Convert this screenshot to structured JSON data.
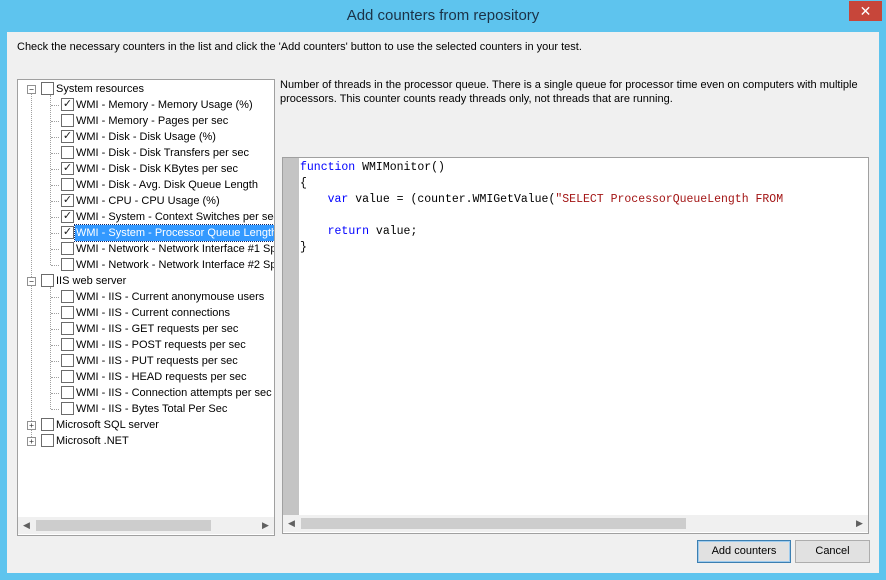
{
  "window": {
    "title": "Add counters from repository",
    "close_glyph": "✕"
  },
  "instruction": "Check the necessary counters in the list and click the 'Add counters' button to use the selected counters in your test.",
  "tree": {
    "groups": [
      {
        "label": "System resources",
        "expander": "−",
        "checked": false,
        "items": [
          {
            "label": "WMI - Memory - Memory Usage (%)",
            "checked": true
          },
          {
            "label": "WMI - Memory - Pages per sec",
            "checked": false
          },
          {
            "label": "WMI - Disk - Disk Usage (%)",
            "checked": true
          },
          {
            "label": "WMI - Disk - Disk Transfers per sec",
            "checked": false
          },
          {
            "label": "WMI - Disk - Disk KBytes per sec",
            "checked": true
          },
          {
            "label": "WMI - Disk - Avg. Disk Queue Length",
            "checked": false
          },
          {
            "label": "WMI - CPU - CPU Usage (%)",
            "checked": true
          },
          {
            "label": "WMI - System - Context Switches per sec",
            "checked": true
          },
          {
            "label": "WMI - System - Processor Queue Length",
            "checked": true,
            "selected": true
          },
          {
            "label": "WMI - Network - Network Interface #1 Sp",
            "checked": false
          },
          {
            "label": "WMI - Network - Network Interface #2 Sp",
            "checked": false
          }
        ]
      },
      {
        "label": "IIS web server",
        "expander": "−",
        "checked": false,
        "items": [
          {
            "label": "WMI - IIS - Current anonymouse users",
            "checked": false
          },
          {
            "label": "WMI - IIS - Current connections",
            "checked": false
          },
          {
            "label": "WMI - IIS - GET requests per sec",
            "checked": false
          },
          {
            "label": "WMI - IIS - POST requests per sec",
            "checked": false
          },
          {
            "label": "WMI - IIS - PUT requests per sec",
            "checked": false
          },
          {
            "label": "WMI - IIS - HEAD requests per sec",
            "checked": false
          },
          {
            "label": "WMI - IIS - Connection attempts per sec",
            "checked": false
          },
          {
            "label": "WMI - IIS - Bytes Total Per Sec",
            "checked": false
          }
        ]
      },
      {
        "label": "Microsoft SQL server",
        "expander": "+",
        "checked": false,
        "items": []
      },
      {
        "label": "Microsoft .NET",
        "expander": "+",
        "checked": false,
        "items": []
      }
    ]
  },
  "description": "Number of threads in the processor queue. There is a single queue for processor time even on computers with multiple processors. This counter counts ready threads only, not threads that are running.",
  "code": {
    "line1_kw": "function",
    "line1_rest": " WMIMonitor()",
    "line2": "{",
    "line3_indent": "    ",
    "line3_kw": "var",
    "line3_mid": " value = (counter.WMIGetValue(",
    "line3_str": "\"SELECT ProcessorQueueLength FROM",
    "line4": "",
    "line5_indent": "    ",
    "line5_kw": "return",
    "line5_rest": " value;",
    "line6": "}"
  },
  "scroll": {
    "left_arrow": "◀",
    "right_arrow": "▶"
  },
  "buttons": {
    "add_counters": "Add counters",
    "cancel": "Cancel"
  }
}
